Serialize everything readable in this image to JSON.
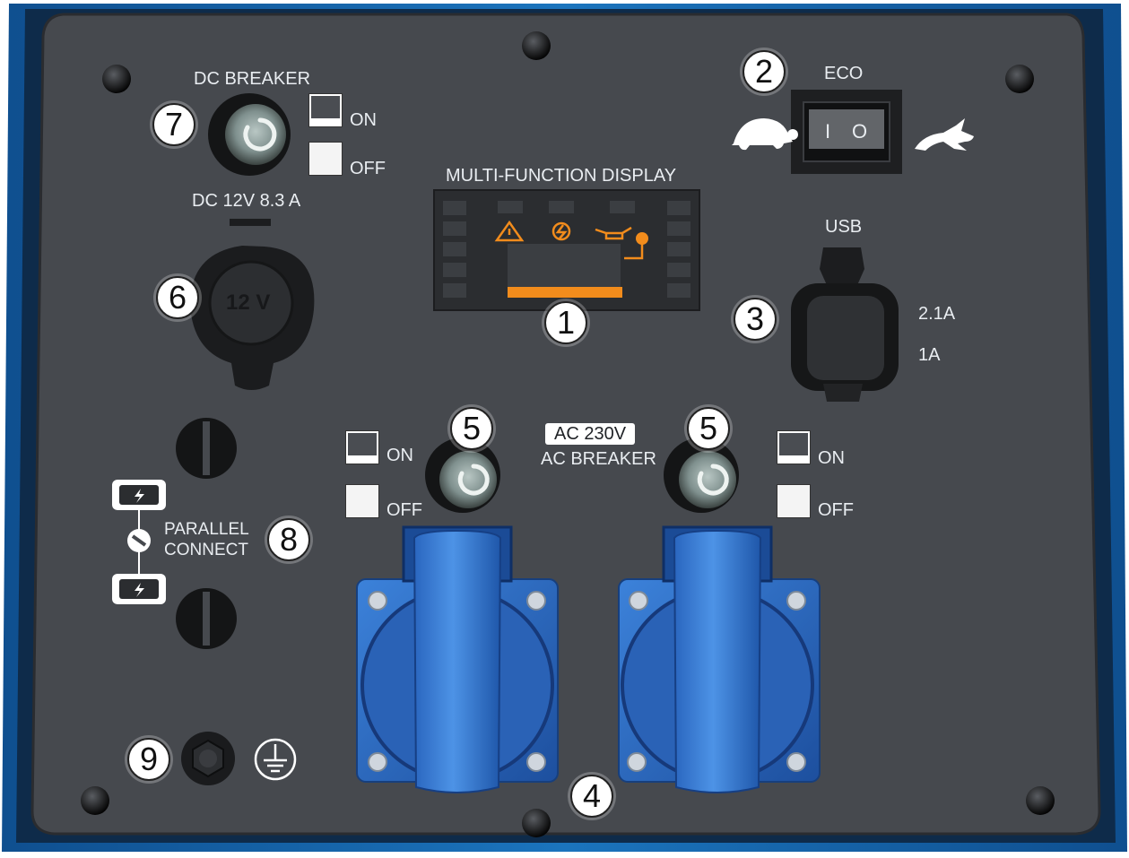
{
  "labels": {
    "dc_breaker": "DC BREAKER",
    "dc_rating": "DC 12V 8.3 A",
    "display": "MULTI-FUNCTION DISPLAY",
    "eco": "ECO",
    "usb": "USB",
    "usb_high": "2.1A",
    "usb_low": "1A",
    "ac_voltage": "AC 230V",
    "ac_breaker": "AC BREAKER",
    "parallel_1": "PARALLEL",
    "parallel_2": "CONNECT",
    "on": "ON",
    "off": "OFF",
    "socket_12v": "12 V",
    "eco_switch_on": "I",
    "eco_switch_off": "O"
  },
  "callouts": [
    "1",
    "2",
    "3",
    "4",
    "5",
    "5",
    "6",
    "7",
    "8",
    "9"
  ],
  "colors": {
    "frame_blue": "#1a6fb5",
    "panel": "#46494e",
    "socket_blue": "#2f6cc4",
    "display_orange": "#f28c1c"
  },
  "icons": [
    "warning-icon",
    "power-icon",
    "oil-can-icon",
    "turtle-icon",
    "rabbit-icon",
    "ground-icon",
    "battery-icon",
    "chain-link-icon",
    "screw-icon"
  ]
}
